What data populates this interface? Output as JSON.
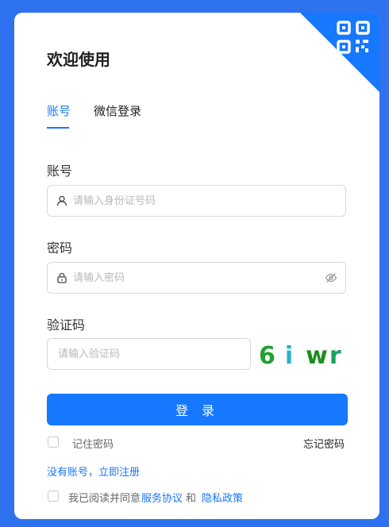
{
  "header": {
    "title": "欢迎使用"
  },
  "tabs": [
    {
      "label": "账号"
    },
    {
      "label": "微信登录"
    }
  ],
  "form": {
    "account_label": "账号",
    "account_placeholder": "请输入身份证号码",
    "password_label": "密码",
    "password_placeholder": "请输入密码",
    "captcha_label": "验证码",
    "captcha_placeholder": "请输入验证码",
    "captcha_chars": [
      "6",
      "i",
      "w",
      "r"
    ]
  },
  "login_label": "登 录",
  "options": {
    "remember_label": "记住密码",
    "forgot_label": "忘记密码",
    "register_label": "没有账号，立即注册",
    "agree_prefix": "我已阅读并同意",
    "agree_service": "服务协议",
    "agree_and": "和",
    "agree_privacy": "隐私政策"
  },
  "colors": {
    "background": "#2f72f0",
    "accent": "#1677ff"
  },
  "icons": {
    "qr": "qr-code-icon",
    "user": "user-icon",
    "lock": "lock-icon",
    "eye": "eye-off-icon"
  }
}
